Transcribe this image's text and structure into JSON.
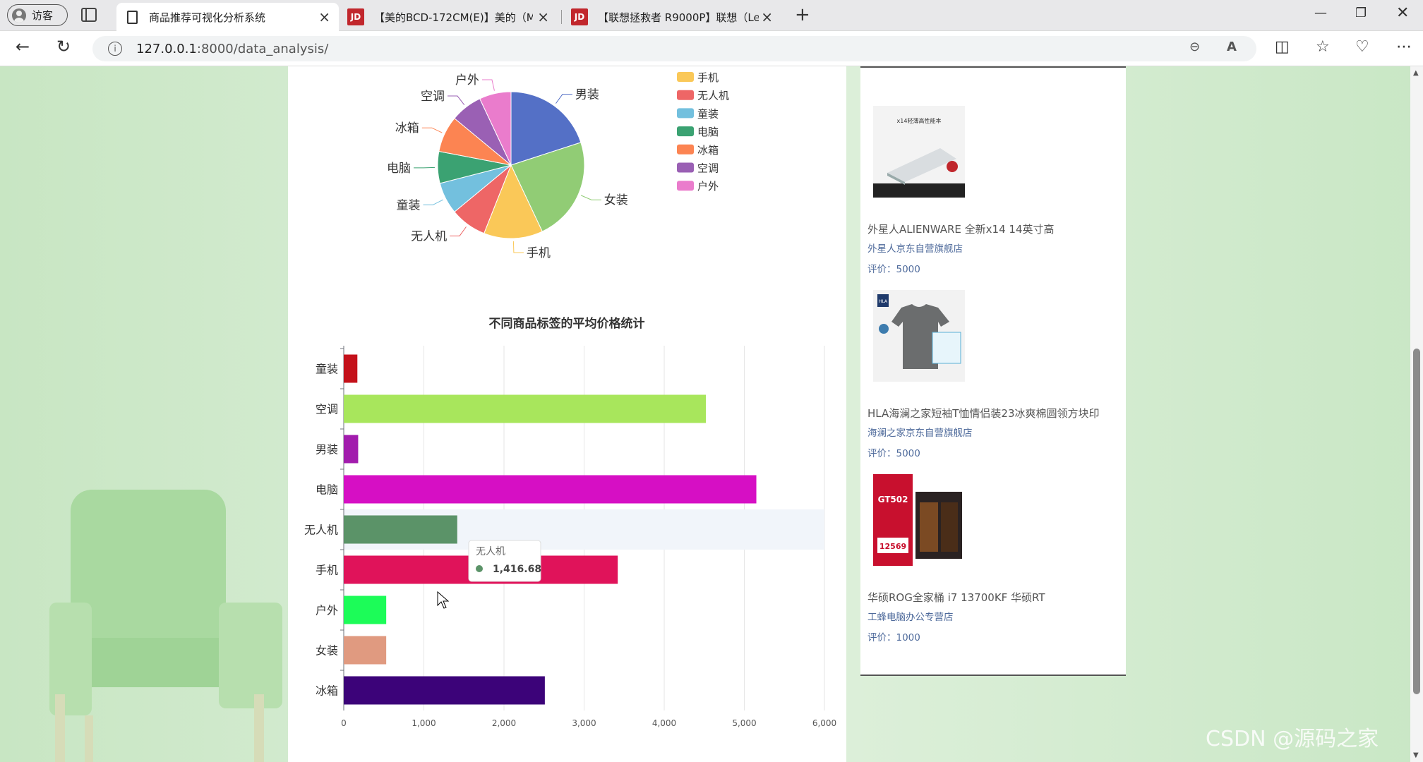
{
  "browser": {
    "profile_label": "访客",
    "tabs": [
      {
        "title": "商品推荐可视化分析系统",
        "active": true,
        "favicon": "page-icon"
      },
      {
        "title": "【美的BCD-172CM(E)】美的（M",
        "active": false,
        "favicon": "jd-icon"
      },
      {
        "title": "【联想拯救者 R9000P】联想（Le",
        "active": false,
        "favicon": "jd-icon"
      }
    ],
    "favicon_text": "JD",
    "url_host": "127.0.0.1",
    "url_rest": ":8000/data_analysis/"
  },
  "pie": {
    "chart_data": {
      "type": "pie",
      "legend": [
        "手机",
        "无人机",
        "童装",
        "电脑",
        "冰箱",
        "空调",
        "户外"
      ],
      "slice_labels": [
        "男装",
        "女装",
        "手机",
        "无人机",
        "童装",
        "电脑",
        "冰箱",
        "空调",
        "户外"
      ],
      "slices": [
        {
          "name": "男装",
          "value": 20,
          "color": "#5470c6"
        },
        {
          "name": "女装",
          "value": 23,
          "color": "#91cc75"
        },
        {
          "name": "手机",
          "value": 13,
          "color": "#fac858"
        },
        {
          "name": "无人机",
          "value": 8,
          "color": "#ee6666"
        },
        {
          "name": "童装",
          "value": 7,
          "color": "#73c0de"
        },
        {
          "name": "电脑",
          "value": 7,
          "color": "#3ba272"
        },
        {
          "name": "冰箱",
          "value": 8,
          "color": "#fc8452"
        },
        {
          "name": "空调",
          "value": 7,
          "color": "#9a60b4"
        },
        {
          "name": "户外",
          "value": 7,
          "color": "#ea7ccc"
        }
      ],
      "legend_placement": "top-right"
    }
  },
  "bar": {
    "chart_data": {
      "type": "bar",
      "orientation": "horizontal",
      "title": "不同商品标签的平均价格统计",
      "categories": [
        "童装",
        "空调",
        "男装",
        "电脑",
        "无人机",
        "手机",
        "户外",
        "女装",
        "冰箱"
      ],
      "values": [
        170,
        4520,
        180,
        5150,
        1416.68,
        3420,
        530,
        530,
        2510
      ],
      "colors": [
        "#c4111a",
        "#a8e65c",
        "#a21cad",
        "#d60fc4",
        "#5b9368",
        "#e0135a",
        "#1cfc58",
        "#e09a80",
        "#3c0379"
      ],
      "xlim": [
        0,
        6000
      ],
      "xticks": [
        "0",
        "1,000",
        "2,000",
        "3,000",
        "4,000",
        "5,000",
        "6,000"
      ],
      "grid": true,
      "highlight_category": "无人机"
    },
    "tooltip": {
      "category": "无人机",
      "value": "1,416.68"
    }
  },
  "products": [
    {
      "name": "外星人ALIENWARE 全新x14 14英寸高",
      "shop": "外星人京东自营旗舰店",
      "rating": "评价：5000"
    },
    {
      "name": "HLA海澜之家短袖T恤情侣装23冰爽棉圆领方块印",
      "shop": "海澜之家京东自营旗舰店",
      "rating": "评价：5000"
    },
    {
      "name": "华硕ROG全家桶 i7 13700KF 华硕RT",
      "shop": "工蜂电脑办公专营店",
      "rating": "评价：1000"
    }
  ],
  "thumb_text": {
    "laptop": "x14轻薄高性能本",
    "tshirt_brand": "HLA",
    "pc_brand": "GT502",
    "pc_price": "12569"
  },
  "watermark": "CSDN @源码之家"
}
